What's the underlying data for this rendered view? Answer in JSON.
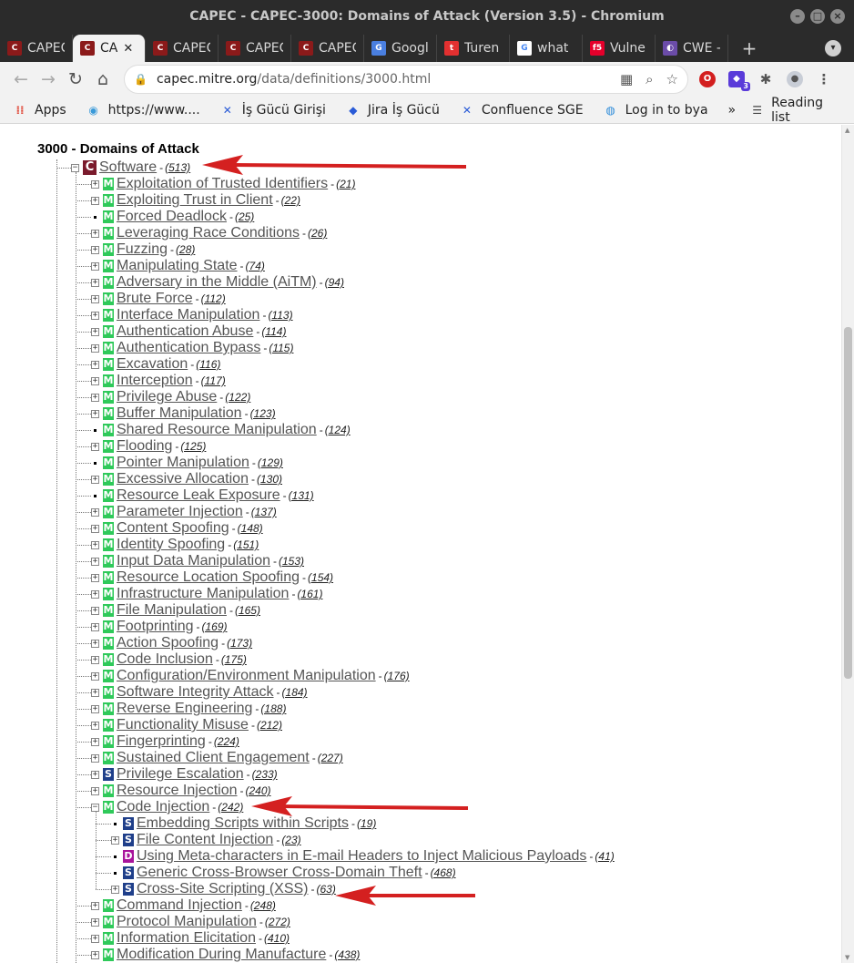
{
  "window": {
    "title": "CAPEC - CAPEC-3000: Domains of Attack (Version 3.5) - Chromium"
  },
  "tabs": [
    {
      "title": "CAPEC",
      "icon": "capec-icon",
      "color": "#8b1a1a",
      "active": false
    },
    {
      "title": "CA",
      "icon": "capec-icon",
      "color": "#8b1a1a",
      "active": true
    },
    {
      "title": "CAPEC",
      "icon": "capec-icon",
      "color": "#8b1a1a",
      "active": false
    },
    {
      "title": "CAPEC",
      "icon": "capec-icon",
      "color": "#8b1a1a",
      "active": false
    },
    {
      "title": "CAPEC",
      "icon": "capec-icon",
      "color": "#8b1a1a",
      "active": false
    },
    {
      "title": "Googl",
      "icon": "google-translate-icon",
      "color": "#4a7fe0",
      "active": false
    },
    {
      "title": "Turen",
      "icon": "t-icon",
      "color": "#e23030",
      "active": false
    },
    {
      "title": "what",
      "icon": "google-icon",
      "color": "#ffffff",
      "active": false
    },
    {
      "title": "Vulne",
      "icon": "f5-icon",
      "color": "#e4002b",
      "active": false
    },
    {
      "title": "CWE -",
      "icon": "cwe-icon",
      "color": "#6b4ca8",
      "active": false
    }
  ],
  "toolbar": {
    "url_host": "capec.mitre.org",
    "url_path": "/data/definitions/3000.html"
  },
  "bookmarks": [
    {
      "label": "Apps",
      "icon": "apps-grid-icon"
    },
    {
      "label": "https://www....",
      "icon": "globe-icon"
    },
    {
      "label": "İş Gücü Girişi",
      "icon": "confluence-icon"
    },
    {
      "label": "Jira İş Gücü",
      "icon": "jira-icon"
    },
    {
      "label": "Confluence SGE",
      "icon": "confluence-icon"
    },
    {
      "label": "Log in to bya",
      "icon": "bya-icon"
    }
  ],
  "bookmarks_more": "»",
  "reading_list": "Reading list",
  "page": {
    "title": "3000 - Domains of Attack",
    "root": {
      "badge": "C",
      "name": "Software",
      "id": "(513)"
    },
    "items": [
      {
        "badge": "M",
        "name": "Exploitation of Trusted Identifiers",
        "id": "(21)",
        "toggle": "+"
      },
      {
        "badge": "M",
        "name": "Exploiting Trust in Client",
        "id": "(22)",
        "toggle": "+"
      },
      {
        "badge": "M",
        "name": "Forced Deadlock",
        "id": "(25)",
        "toggle": "."
      },
      {
        "badge": "M",
        "name": "Leveraging Race Conditions",
        "id": "(26)",
        "toggle": "+"
      },
      {
        "badge": "M",
        "name": "Fuzzing",
        "id": "(28)",
        "toggle": "+"
      },
      {
        "badge": "M",
        "name": "Manipulating State",
        "id": "(74)",
        "toggle": "+"
      },
      {
        "badge": "M",
        "name": "Adversary in the Middle (AiTM)",
        "id": "(94)",
        "toggle": "+"
      },
      {
        "badge": "M",
        "name": "Brute Force",
        "id": "(112)",
        "toggle": "+"
      },
      {
        "badge": "M",
        "name": "Interface Manipulation",
        "id": "(113)",
        "toggle": "+"
      },
      {
        "badge": "M",
        "name": "Authentication Abuse",
        "id": "(114)",
        "toggle": "+"
      },
      {
        "badge": "M",
        "name": "Authentication Bypass",
        "id": "(115)",
        "toggle": "+"
      },
      {
        "badge": "M",
        "name": "Excavation",
        "id": "(116)",
        "toggle": "+"
      },
      {
        "badge": "M",
        "name": "Interception",
        "id": "(117)",
        "toggle": "+"
      },
      {
        "badge": "M",
        "name": "Privilege Abuse",
        "id": "(122)",
        "toggle": "+"
      },
      {
        "badge": "M",
        "name": "Buffer Manipulation",
        "id": "(123)",
        "toggle": "+"
      },
      {
        "badge": "M",
        "name": "Shared Resource Manipulation",
        "id": "(124)",
        "toggle": "."
      },
      {
        "badge": "M",
        "name": "Flooding",
        "id": "(125)",
        "toggle": "+"
      },
      {
        "badge": "M",
        "name": "Pointer Manipulation",
        "id": "(129)",
        "toggle": "."
      },
      {
        "badge": "M",
        "name": "Excessive Allocation",
        "id": "(130)",
        "toggle": "+"
      },
      {
        "badge": "M",
        "name": "Resource Leak Exposure",
        "id": "(131)",
        "toggle": "."
      },
      {
        "badge": "M",
        "name": "Parameter Injection",
        "id": "(137)",
        "toggle": "+"
      },
      {
        "badge": "M",
        "name": "Content Spoofing",
        "id": "(148)",
        "toggle": "+"
      },
      {
        "badge": "M",
        "name": "Identity Spoofing",
        "id": "(151)",
        "toggle": "+"
      },
      {
        "badge": "M",
        "name": "Input Data Manipulation",
        "id": "(153)",
        "toggle": "+"
      },
      {
        "badge": "M",
        "name": "Resource Location Spoofing",
        "id": "(154)",
        "toggle": "+"
      },
      {
        "badge": "M",
        "name": "Infrastructure Manipulation",
        "id": "(161)",
        "toggle": "+"
      },
      {
        "badge": "M",
        "name": "File Manipulation",
        "id": "(165)",
        "toggle": "+"
      },
      {
        "badge": "M",
        "name": "Footprinting",
        "id": "(169)",
        "toggle": "+"
      },
      {
        "badge": "M",
        "name": "Action Spoofing",
        "id": "(173)",
        "toggle": "+"
      },
      {
        "badge": "M",
        "name": "Code Inclusion",
        "id": "(175)",
        "toggle": "+"
      },
      {
        "badge": "M",
        "name": "Configuration/Environment Manipulation",
        "id": "(176)",
        "toggle": "+"
      },
      {
        "badge": "M",
        "name": "Software Integrity Attack",
        "id": "(184)",
        "toggle": "+"
      },
      {
        "badge": "M",
        "name": "Reverse Engineering",
        "id": "(188)",
        "toggle": "+"
      },
      {
        "badge": "M",
        "name": "Functionality Misuse",
        "id": "(212)",
        "toggle": "+"
      },
      {
        "badge": "M",
        "name": "Fingerprinting",
        "id": "(224)",
        "toggle": "+"
      },
      {
        "badge": "M",
        "name": "Sustained Client Engagement",
        "id": "(227)",
        "toggle": "+"
      },
      {
        "badge": "S",
        "name": "Privilege Escalation",
        "id": "(233)",
        "toggle": "+"
      },
      {
        "badge": "M",
        "name": "Resource Injection",
        "id": "(240)",
        "toggle": "+"
      },
      {
        "badge": "M",
        "name": "Code Injection",
        "id": "(242)",
        "toggle": "-",
        "children": [
          {
            "badge": "S",
            "name": "Embedding Scripts within Scripts",
            "id": "(19)",
            "toggle": "."
          },
          {
            "badge": "S",
            "name": "File Content Injection",
            "id": "(23)",
            "toggle": "+"
          },
          {
            "badge": "D",
            "name": "Using Meta-characters in E-mail Headers to Inject Malicious Payloads",
            "id": "(41)",
            "toggle": "."
          },
          {
            "badge": "S",
            "name": "Generic Cross-Browser Cross-Domain Theft",
            "id": "(468)",
            "toggle": "."
          },
          {
            "badge": "S",
            "name": "Cross-Site Scripting (XSS)",
            "id": "(63)",
            "toggle": "+"
          }
        ]
      },
      {
        "badge": "M",
        "name": "Command Injection",
        "id": "(248)",
        "toggle": "+"
      },
      {
        "badge": "M",
        "name": "Protocol Manipulation",
        "id": "(272)",
        "toggle": "+"
      },
      {
        "badge": "M",
        "name": "Information Elicitation",
        "id": "(410)",
        "toggle": "+"
      },
      {
        "badge": "M",
        "name": "Modification During Manufacture",
        "id": "(438)",
        "toggle": "+"
      }
    ]
  },
  "annotation_color": "#d42020"
}
